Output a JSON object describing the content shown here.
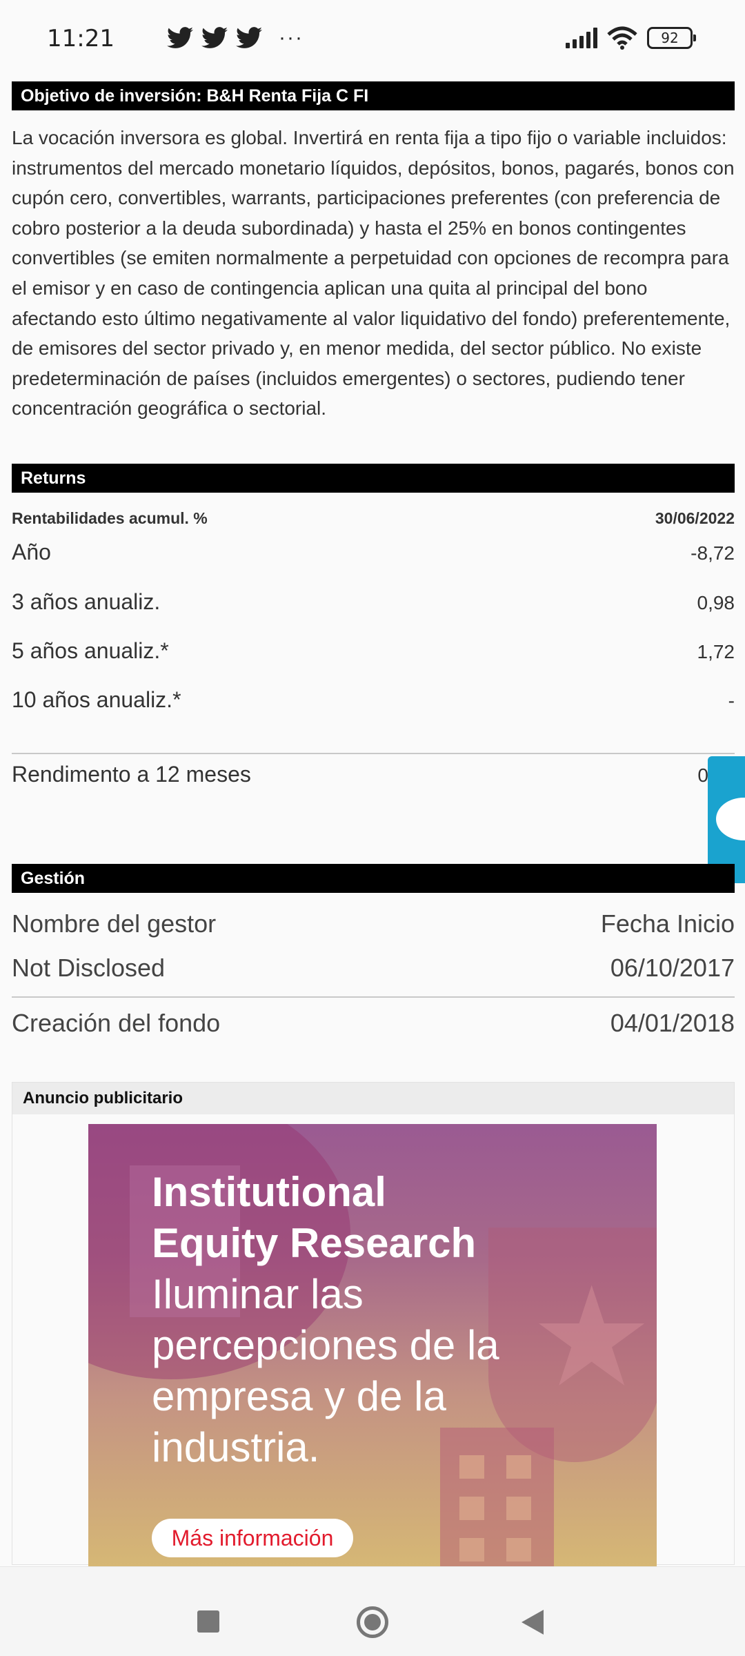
{
  "status_bar": {
    "time": "11:21",
    "more": "···",
    "battery": "92"
  },
  "objective": {
    "header": "Objetivo de inversión: B&H Renta Fija C FI",
    "text": "La vocación inversora es global. Invertirá en renta fija a tipo fijo o variable incluidos: instrumentos del mercado monetario líquidos, depósitos, bonos, pagarés, bonos con cupón cero, convertibles, warrants, participaciones preferentes (con preferencia de cobro posterior a la deuda subordinada) y hasta el 25% en bonos contingentes convertibles (se emiten normalmente a perpetuidad con opciones de recompra para el emisor y en caso de contingencia aplican una quita al principal del bono afectando esto último negativamente al valor liquidativo del fondo) preferentemente, de emisores del sector privado y, en menor medida, del sector público. No existe predeterminación de países (incluidos emergentes) o sectores, pudiendo tener concentración geográfica o sectorial."
  },
  "returns": {
    "header": "Returns",
    "table_label": "Rentabilidades acumul. %",
    "date": "30/06/2022",
    "rows": [
      {
        "label": "Año",
        "value": "-8,72"
      },
      {
        "label": "3 años anualiz.",
        "value": "0,98"
      },
      {
        "label": "5 años anualiz.*",
        "value": "1,72"
      },
      {
        "label": "10 años anualiz.*",
        "value": "-"
      }
    ],
    "yield_label": "Rendimento a 12 meses",
    "yield_value": "0"
  },
  "management": {
    "header": "Gestión",
    "col_manager": "Nombre del gestor",
    "col_start": "Fecha Inicio",
    "manager_name": "Not Disclosed",
    "manager_start": "06/10/2017",
    "creation_label": "Creación del fondo",
    "creation_date": "04/01/2018"
  },
  "ad": {
    "label": "Anuncio publicitario",
    "title_line1": "Institutional",
    "title_line2": "Equity Research",
    "subtitle": "Iluminar las percepciones de la empresa y de la industria.",
    "button": "Más información"
  },
  "colors": {
    "header_bg": "#000000",
    "accent_tab": "#1aa3cf",
    "ad_button_text": "#e21b2d"
  }
}
